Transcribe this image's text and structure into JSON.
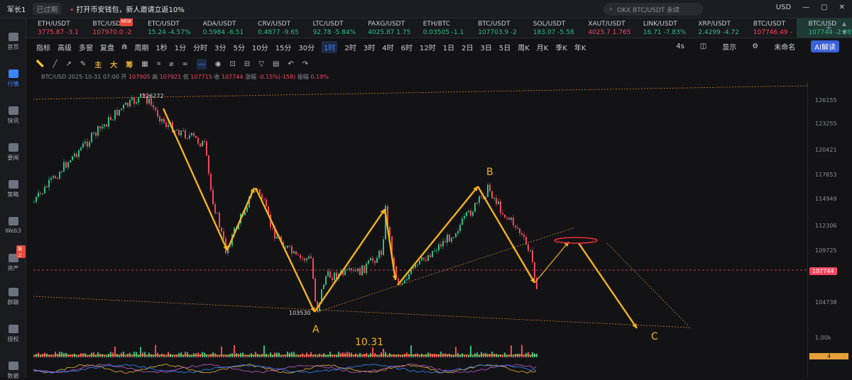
{
  "topbar": {
    "account_name": "军长1",
    "account_badge": "已过期",
    "promo": "打开币安钱包，新人邀请立返10%",
    "search_placeholder": "OKX BTC/USDT 永续",
    "currency": "USD"
  },
  "sidebar": [
    {
      "label": "首页"
    },
    {
      "label": "行情"
    },
    {
      "label": "快讯"
    },
    {
      "label": "要闻"
    },
    {
      "label": "策略"
    },
    {
      "label": "Web3"
    },
    {
      "label": "资产"
    },
    {
      "label": "群聊"
    },
    {
      "label": "授权"
    },
    {
      "label": "数据"
    }
  ],
  "sidebar_badge": "链上",
  "tickers": [
    {
      "name": "ETH/USDT",
      "value": "3775.87 -3.1",
      "dir": "dn"
    },
    {
      "name": "BTC/USD",
      "value": "107970.0 -2",
      "dir": "dn"
    },
    {
      "name": "ETC/USDT",
      "value": "15.24 -4.57%",
      "dir": "up"
    },
    {
      "name": "ADA/USDT",
      "value": "0.5984 -6.51",
      "dir": "up"
    },
    {
      "name": "CRV/USDT",
      "value": "0.4877 -9.65",
      "dir": "up"
    },
    {
      "name": "LTC/USDT",
      "value": "92.78 -5.84%",
      "dir": "up"
    },
    {
      "name": "PAXG/USDT",
      "value": "4025.87 1.75",
      "dir": "up"
    },
    {
      "name": "ETH/BTC",
      "value": "0.03505 -1.1",
      "dir": "up"
    },
    {
      "name": "BTC/USDT",
      "value": "107703.9 -2",
      "dir": "up"
    },
    {
      "name": "SOL/USDT",
      "value": "183.07 -5.58",
      "dir": "up"
    },
    {
      "name": "XAUT/USDT",
      "value": "4025.7 1.765",
      "dir": "dn"
    },
    {
      "name": "LINK/USDT",
      "value": "16.71 -7.83%",
      "dir": "up"
    },
    {
      "name": "XRP/USDT",
      "value": "2.4299 -4.72",
      "dir": "up"
    },
    {
      "name": "BTC/USDT",
      "value": "107746.49 -",
      "dir": "dn"
    },
    {
      "name": "BTC/USD",
      "value": "107744 -2.08%",
      "dir": "up"
    }
  ],
  "ticker_new_badge": "NEW",
  "toolbar": {
    "left": [
      "指标",
      "高级",
      "多窗",
      "复盘"
    ],
    "periods": [
      "周期",
      "1秒",
      "1分",
      "分时",
      "3分",
      "5分",
      "10分",
      "15分",
      "30分",
      "1时",
      "2时",
      "3时",
      "4时",
      "6时",
      "12时",
      "1日",
      "2日",
      "3日",
      "5日",
      "周K",
      "月K",
      "季K",
      "年K"
    ],
    "active_period": "1时",
    "right": [
      "4s",
      "显示",
      "未命名"
    ],
    "ai_button": "AI解读"
  },
  "drawbar": {
    "hl": [
      "主",
      "大",
      "筹"
    ]
  },
  "ohlc": {
    "symbol": "BTC/USD",
    "time": "2025-10-31 07:00",
    "open_label": "开",
    "open": "107905",
    "high_label": "高",
    "high": "107921",
    "low_label": "低",
    "low": "107715",
    "close_label": "收",
    "close": "107744",
    "change_label": "涨幅",
    "change": "-0.15%(-158)",
    "amp_label": "振幅",
    "amp": "0.19%"
  },
  "chart": {
    "ticks": [
      "126155",
      "123255",
      "120421",
      "117653",
      "114949",
      "112306",
      "109725",
      "104738"
    ],
    "price_tag": "107744",
    "vol_label": "1.00k",
    "vol_tag": "4",
    "high_marker": "126272",
    "low_marker": "103530",
    "annot_a": "A",
    "annot_b": "B",
    "annot_c": "C",
    "date_label": "10.31",
    "colors": {
      "up": "#2ebd85",
      "down": "#f6465d",
      "arrow": "#f5b21b",
      "ellipse": "#e8303a"
    }
  }
}
